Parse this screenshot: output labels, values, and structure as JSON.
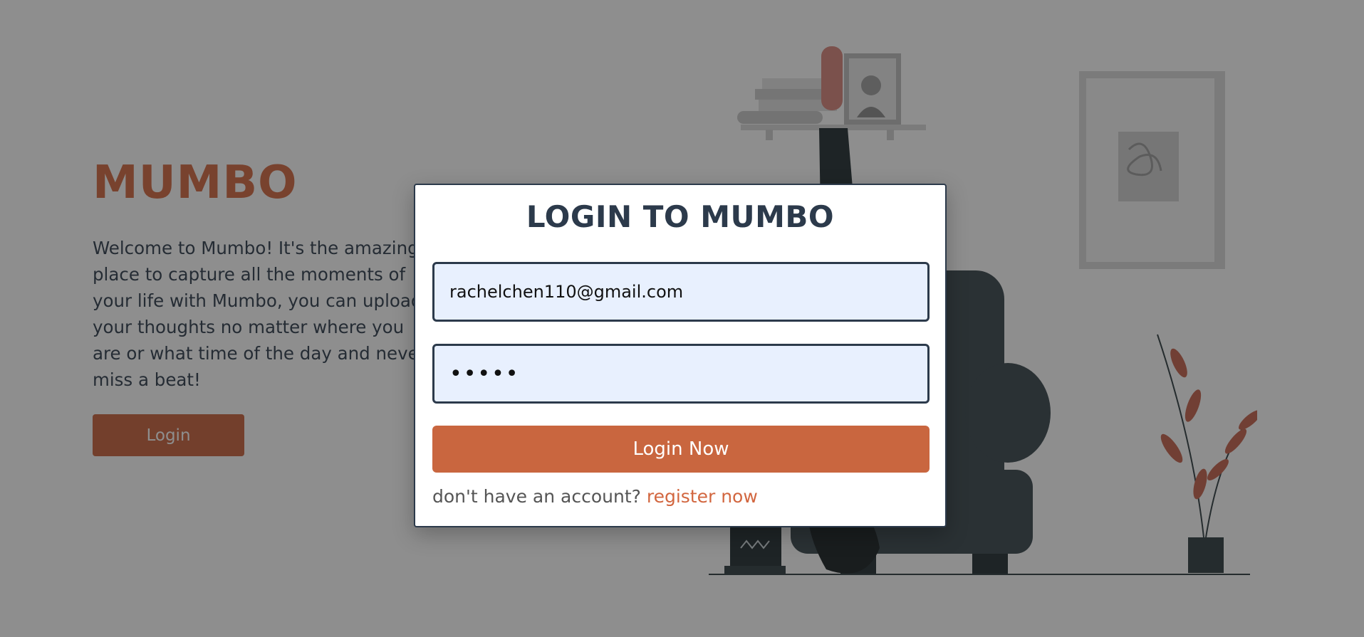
{
  "hero": {
    "brand": "MUMBO",
    "welcome": "Welcome to Mumbo! It's the amazing place to capture all the moments of your life with Mumbo, you can upload your thoughts no matter where you are or what time of the day and never miss a beat!",
    "login_button": "Login"
  },
  "modal": {
    "title": "LOGIN TO MUMBO",
    "email_value": "rachelchen110@gmail.com",
    "password_value": "•••••",
    "submit_label": "Login Now",
    "register_prompt": "don't have an account?",
    "register_link": "register now"
  },
  "colors": {
    "accent": "#d2663f",
    "button": "#c9663f",
    "text_dark": "#2c3a4b",
    "input_bg": "#e8f0fe",
    "overlay": "rgba(30,30,30,0.5)"
  }
}
